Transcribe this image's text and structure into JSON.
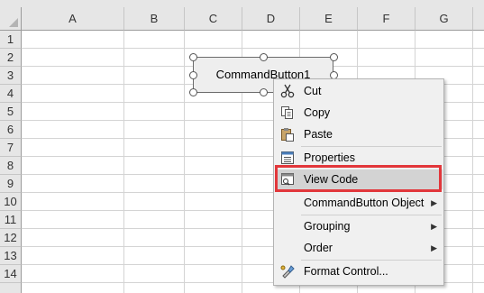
{
  "columns": [
    "A",
    "B",
    "C",
    "D",
    "E",
    "F",
    "G"
  ],
  "rows": [
    "1",
    "2",
    "3",
    "4",
    "5",
    "6",
    "7",
    "8",
    "9",
    "10",
    "11",
    "12",
    "13",
    "14"
  ],
  "command_button": {
    "label": "CommandButton1"
  },
  "context_menu": {
    "items": [
      {
        "label": "Cut",
        "icon": "scissors-icon"
      },
      {
        "label": "Copy",
        "icon": "copy-icon"
      },
      {
        "label": "Paste",
        "icon": "paste-icon"
      },
      {
        "label": "Properties",
        "icon": "properties-icon"
      },
      {
        "label": "View Code",
        "icon": "view-code-icon",
        "highlighted": true
      },
      {
        "label": "CommandButton Object",
        "submenu": true
      },
      {
        "label": "Grouping",
        "submenu": true
      },
      {
        "label": "Order",
        "submenu": true
      },
      {
        "label": "Format Control...",
        "icon": "format-control-icon"
      }
    ]
  },
  "colors": {
    "highlight_outline": "#e2373b",
    "header_bg": "#e6e6e6",
    "grid_line": "#d4d4d4",
    "menu_bg": "#f0f0f0"
  }
}
